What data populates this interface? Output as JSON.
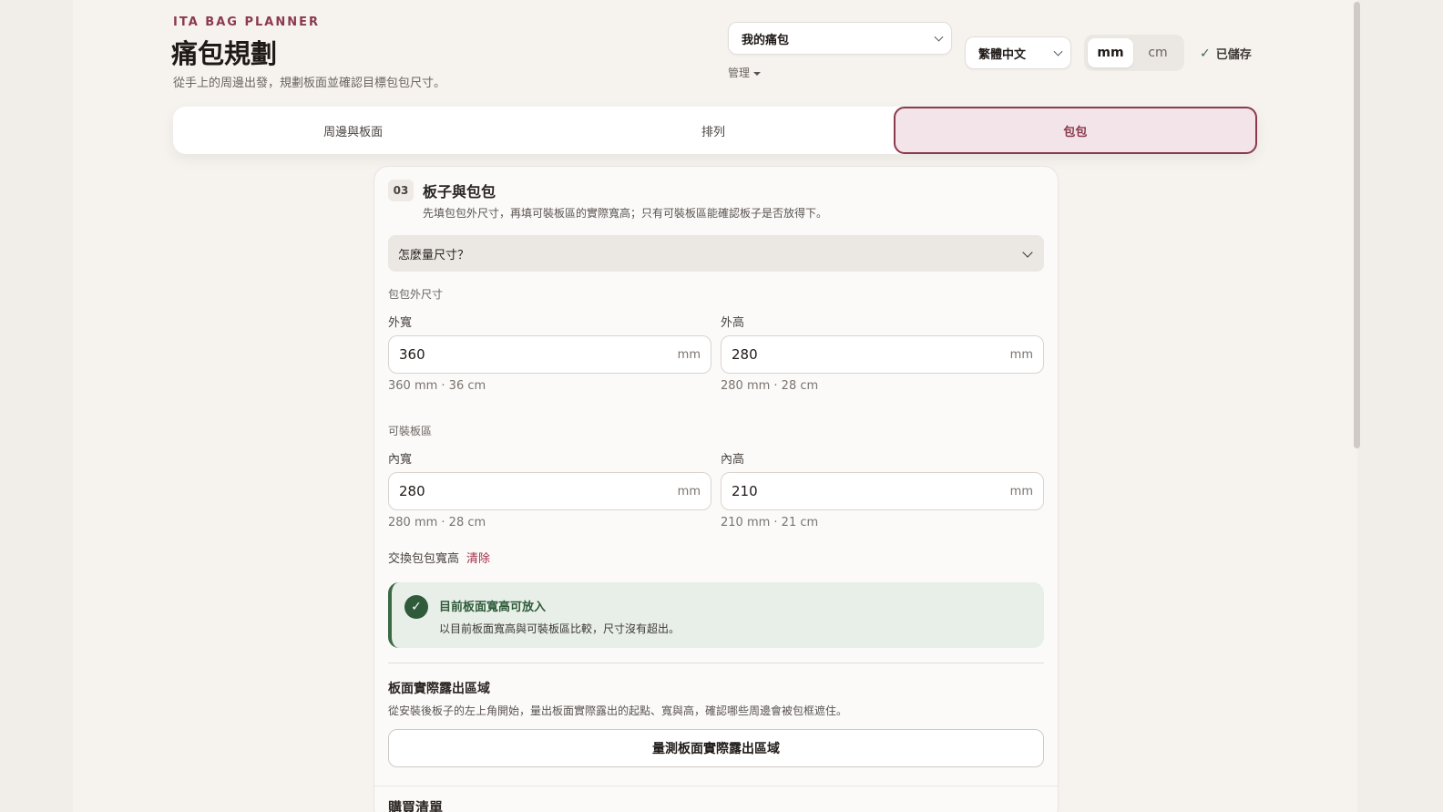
{
  "header": {
    "brand": "ITA BAG PLANNER",
    "title": "痛包規劃",
    "subtitle": "從手上的周邊出發，規劃板面並確認目標包包尺寸。",
    "bag_select_value": "我的痛包",
    "manage_label": "管理",
    "language_value": "繁體中文",
    "units": [
      "mm",
      "cm"
    ],
    "active_unit": "mm",
    "saved_label": "已儲存"
  },
  "tabs": [
    {
      "label": "周邊與板面",
      "active": false
    },
    {
      "label": "排列",
      "active": false
    },
    {
      "label": "包包",
      "active": true
    }
  ],
  "card": {
    "step": "03",
    "title": "板子與包包",
    "description": "先填包包外尺寸，再填可裝板區的實際寬高；只有可裝板區能確認板子是否放得下。",
    "accordion_label": "怎麼量尺寸？",
    "outer_section": "包包外尺寸",
    "outer_width_label": "外寬",
    "outer_width_value": "360",
    "outer_width_hint": "360 mm · 36 cm",
    "outer_height_label": "外高",
    "outer_height_value": "280",
    "outer_height_hint": "280 mm · 28 cm",
    "inner_section": "可裝板區",
    "inner_width_label": "內寬",
    "inner_width_value": "280",
    "inner_width_hint": "280 mm · 28 cm",
    "inner_height_label": "內高",
    "inner_height_value": "210",
    "inner_height_hint": "210 mm · 21 cm",
    "unit_suffix": "mm",
    "swap_label": "交換包包寬高",
    "clear_label": "清除",
    "status_title": "目前板面寬高可放入",
    "status_desc": "以目前板面寬高與可裝板區比較，尺寸沒有超出。",
    "exposed_title": "板面實際露出區域",
    "exposed_desc": "從安裝後板子的左上角開始，量出板面實際露出的起點、寬與高，確認哪些周邊會被包框遮住。",
    "measure_button": "量測板面實際露出區域",
    "next_section_title": "購買清單"
  },
  "colors": {
    "accent": "#8a3a4c",
    "success": "#2f5b3a",
    "clear_link": "#a13048"
  }
}
